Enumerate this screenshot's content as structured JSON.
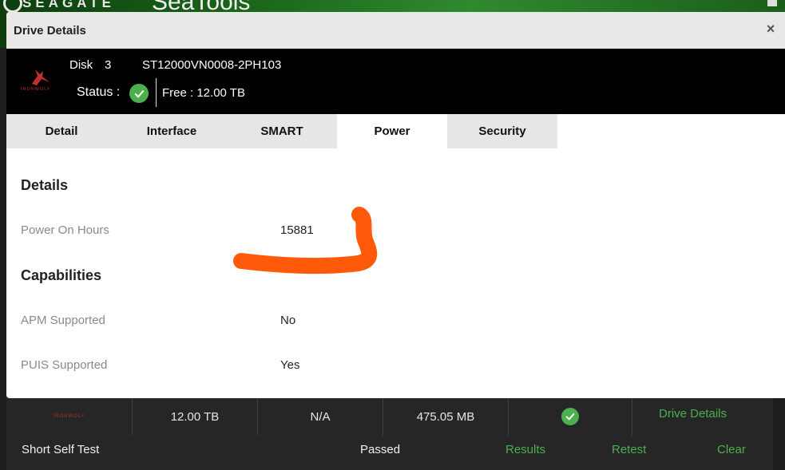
{
  "background": {
    "brand": "SEAGATE",
    "product": "SeaTools",
    "row": {
      "capacity": "12.00 TB",
      "na": "N/A",
      "size": "475.05 MB",
      "drive_details_link": "Drive Details",
      "logo_text": "IRONWOLF"
    },
    "self_test": {
      "label": "Short Self Test",
      "result": "Passed",
      "results_link": "Results",
      "retest_link": "Retest",
      "clear_link": "Clear"
    }
  },
  "modal": {
    "title": "Drive Details",
    "close": "×",
    "drive": {
      "logo_text": "IRONWOLF",
      "disk_label": "Disk",
      "disk_number": "3",
      "model": "ST12000VN0008-2PH103",
      "status_label": "Status :",
      "free": "Free : 12.00 TB"
    },
    "tabs": [
      {
        "label": "Detail",
        "active": false
      },
      {
        "label": "Interface",
        "active": false
      },
      {
        "label": "SMART",
        "active": false
      },
      {
        "label": "Power",
        "active": true
      },
      {
        "label": "Security",
        "active": false
      }
    ],
    "sections": {
      "details_title": "Details",
      "power_on_hours_label": "Power On Hours",
      "power_on_hours_value": "15881",
      "capabilities_title": "Capabilities",
      "apm_label": "APM Supported",
      "apm_value": "No",
      "puis_label": "PUIS Supported",
      "puis_value": "Yes"
    }
  },
  "colors": {
    "accent_green": "#4caf50",
    "annotation_orange": "#ff5a0a",
    "brand_red": "#c03030"
  }
}
